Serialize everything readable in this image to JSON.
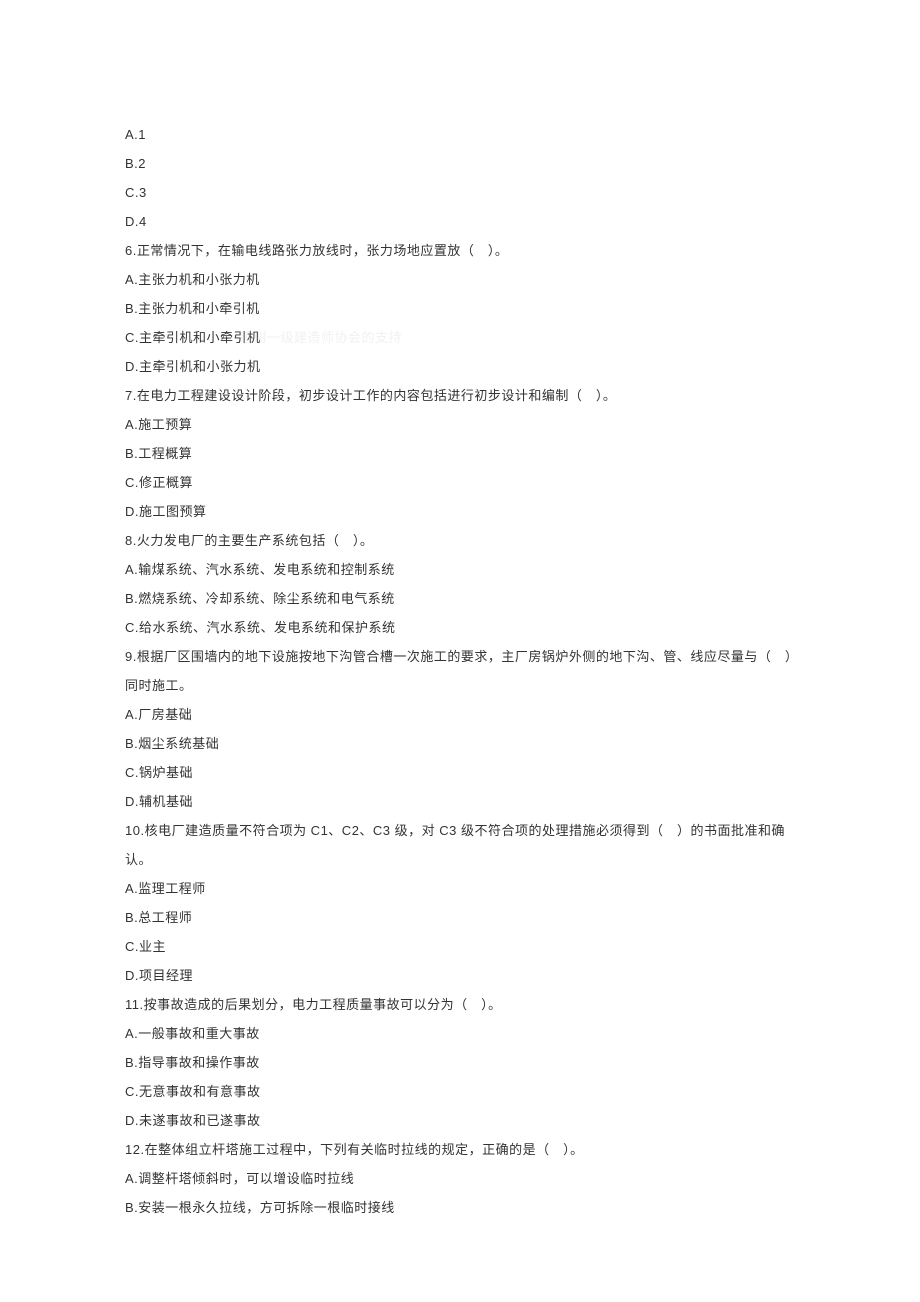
{
  "lines": [
    "A.1",
    "B.2",
    "C.3",
    "D.4",
    "6.正常情况下，在输电线路张力放线时，张力场地应置放（　）。",
    "A.主张力机和小张力机",
    "B.主张力机和小牵引机",
    "C.主牵引机和小牵引机",
    "D.主牵引机和小张力机",
    "7.在电力工程建设设计阶段，初步设计工作的内容包括进行初步设计和编制（　）。",
    "A.施工预算",
    "B.工程概算",
    "C.修正概算",
    "D.施工图预算",
    "8.火力发电厂的主要生产系统包括（　）。",
    "A.输煤系统、汽水系统、发电系统和控制系统",
    "B.燃烧系统、冷却系统、除尘系统和电气系统",
    "C.给水系统、汽水系统、发电系统和保护系统",
    "9.根据厂区围墙内的地下设施按地下沟管合槽一次施工的要求，主厂房锅炉外侧的地下沟、管、线应尽量与（　）同时施工。",
    "A.厂房基础",
    "B.烟尘系统基础",
    "C.锅炉基础",
    "D.辅机基础",
    "10.核电厂建造质量不符合项为 C1、C2、C3 级，对 C3 级不符合项的处理措施必须得到（　）的书面批准和确认。",
    "A.监理工程师",
    "B.总工程师",
    "C.业主",
    "D.项目经理",
    "11.按事故造成的后果划分，电力工程质量事故可以分为（　）。",
    "A.一般事故和重大事故",
    "B.指导事故和操作事故",
    "C.无意事故和有意事故",
    "D.未遂事故和已遂事故",
    "12.在整体组立杆塔施工过程中，下列有关临时拉线的规定，正确的是（　）。",
    "A.调整杆塔倾斜时，可以增设临时拉线",
    "B.安装一根永久拉线，方可拆除一根临时接线"
  ],
  "watermark_index": 7
}
